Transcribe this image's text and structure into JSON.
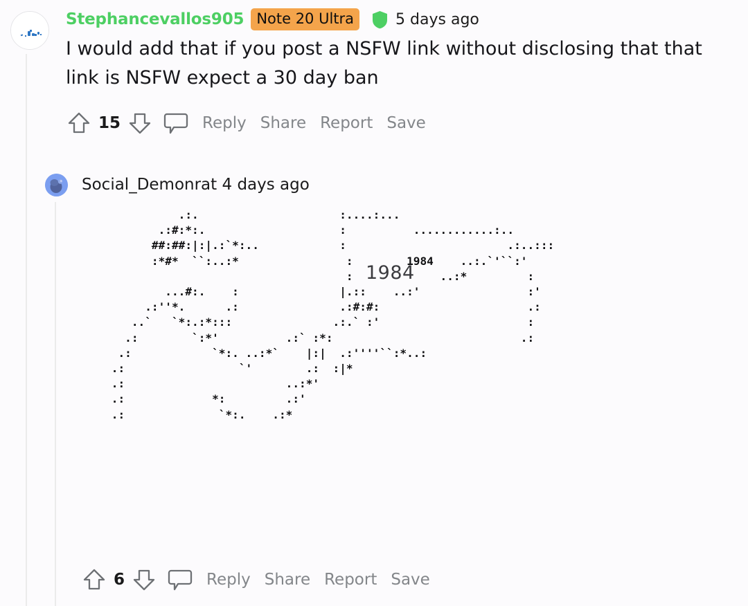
{
  "thread": {
    "comment": {
      "author": "Stephancevallos905",
      "flair": "Note 20 Ultra",
      "timestamp": "5 days ago",
      "shield_color": "#4dcf63",
      "flair_bg": "#f4a44b",
      "author_color": "#4dcf63",
      "body": "I would add that if you post a NSFW link without disclosing that that link is NSFW expect a 30 day ban",
      "score": "15",
      "actions": {
        "reply": "Reply",
        "share": "Share",
        "report": "Report",
        "save": "Save"
      }
    },
    "reply": {
      "author": "Social_Demonrat",
      "timestamp": "4 days ago",
      "score": "6",
      "ascii_label": "1984",
      "ascii_art": "              .:.                     :....:...\n           .:#:*:.                    :          ............:..\n          ##:##:|:|.:`*:..            :                        .:..:::\n          :*#*  ``:..:*                :        1984    ..:.`'``:'\n                                       :             ..:*         :\n            ...#:.    :               |.::    ..:'                :'\n         .:''*.      .:               .:#:#:                      .:\n       ..`   `*:.:*:::               .:.` :'                      :\n      .:        `:*'          .:` :*:                            .:\n     .:            `*:. ..:*`    |:|  .:''''``:*..:\n    .:                 `'        .:  :|*\n    .:                        ..:*'\n    .:             *:         .:'\n    .:              `*:.    .:*",
      "actions": {
        "reply": "Reply",
        "share": "Share",
        "report": "Report",
        "save": "Save"
      }
    }
  },
  "icons": {
    "upvote": "upvote-arrow-icon",
    "downvote": "downvote-arrow-icon",
    "comment": "comment-bubble-icon",
    "shield": "verified-shield-icon"
  }
}
